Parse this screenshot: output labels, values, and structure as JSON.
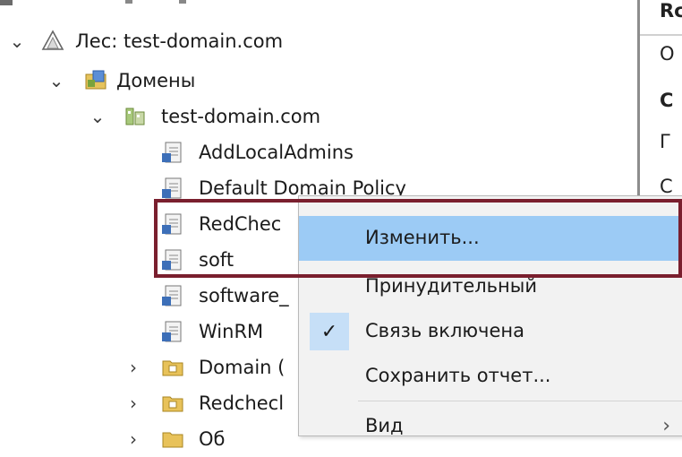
{
  "tree": {
    "items": [
      {
        "label": "Лес: test-domain.com",
        "icon": "forest-icon"
      },
      {
        "label": "Домены",
        "icon": "domains-folder-icon"
      },
      {
        "label": "test-domain.com",
        "icon": "domain-icon"
      },
      {
        "label": "AddLocalAdmins",
        "icon": "gpo-icon"
      },
      {
        "label": "Default Domain Policy",
        "icon": "gpo-icon"
      },
      {
        "label": "RedChec",
        "icon": "gpo-icon"
      },
      {
        "label": "soft",
        "icon": "gpo-icon"
      },
      {
        "label": "software_",
        "icon": "gpo-icon"
      },
      {
        "label": "WinRM",
        "icon": "gpo-icon"
      },
      {
        "label": "Domain (",
        "icon": "ou-icon"
      },
      {
        "label": "Redchecl",
        "icon": "ou-icon"
      },
      {
        "label": "Об",
        "icon": "ou-icon"
      }
    ]
  },
  "right_pane": {
    "letters": [
      "Rc",
      "O",
      "C",
      "Г",
      "С"
    ]
  },
  "context_menu": {
    "items": [
      {
        "label": "Изменить...",
        "highlighted": true
      },
      {
        "label": "Принудительный"
      },
      {
        "label": "Связь включена",
        "checked": true
      },
      {
        "label": "Сохранить отчет..."
      },
      {
        "label": "Вид",
        "submenu": true
      }
    ]
  },
  "colors": {
    "highlight": "#9ccbf5",
    "annotation_box": "#7a1f2e",
    "menu_bg": "#f2f2f2"
  }
}
